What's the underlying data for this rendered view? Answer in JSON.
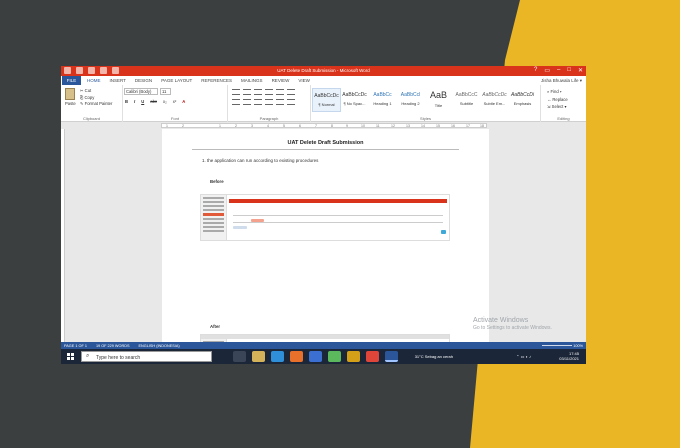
{
  "window": {
    "title": "UAT Delete Draft Submission - Microsoft Word",
    "controls": [
      "?",
      "▭",
      "–",
      "□",
      "✕"
    ]
  },
  "tabs": {
    "file": "FILE",
    "items": [
      "HOME",
      "INSERT",
      "DESIGN",
      "PAGE LAYOUT",
      "REFERENCES",
      "MAILINGS",
      "REVIEW",
      "VIEW"
    ],
    "user": "Jisha Bhuwala Life ▾"
  },
  "ribbon": {
    "clipboard": {
      "paste": "Paste",
      "cut": "✂ Cut",
      "copy": "⎘ Copy",
      "format_painter": "✎ Format Painter",
      "group": "Clipboard"
    },
    "font": {
      "name": "Calibri (Body)",
      "size": "11",
      "bold": "B",
      "italic": "I",
      "underline": "U",
      "strike": "abc",
      "sub": "x₂",
      "sup": "x²",
      "color": "A",
      "group": "Font"
    },
    "paragraph": {
      "group": "Paragraph"
    },
    "styles": {
      "items": [
        {
          "sample": "AaBbCcDc",
          "name": "¶ Normal"
        },
        {
          "sample": "AaBbCcDc",
          "name": "¶ No Spac..."
        },
        {
          "sample": "AaBbCc",
          "name": "Heading 1"
        },
        {
          "sample": "AaBbCcl",
          "name": "Heading 2"
        },
        {
          "sample": "AaB",
          "name": "Title"
        },
        {
          "sample": "AaBbCcC",
          "name": "Subtitle"
        },
        {
          "sample": "AaBbCcDc",
          "name": "Subtle Em..."
        },
        {
          "sample": "AaBbCcDi",
          "name": "Emphasis"
        }
      ],
      "group": "Styles"
    },
    "editing": {
      "find": "⌕ Find ▾",
      "replace": "↔ Replace",
      "select": "⇲ Select ▾",
      "group": "Editing"
    }
  },
  "ruler": {
    "ticks": [
      "1",
      "2",
      "1",
      "2",
      "3",
      "4",
      "5",
      "6",
      "7",
      "8",
      "9",
      "10",
      "11",
      "12",
      "13",
      "14",
      "15",
      "16",
      "17",
      "18"
    ]
  },
  "document": {
    "title": "UAT Delete Draft Submission",
    "step": "1.  the application can run according to existing procedures",
    "before": "Before",
    "after": "After"
  },
  "status": {
    "page": "PAGE 1 OF 1",
    "words": "19 OF 229 WORDS",
    "lang": "ENGLISH (INDONESIA)",
    "zoom": "100%"
  },
  "activation": {
    "line1": "Activate Windows",
    "line2": "Go to Settings to activate Windows."
  },
  "taskbar": {
    "search_placeholder": "Type here to search",
    "weather": "31°C  Sebag an cerah",
    "time": "17:45",
    "date": "03/11/2021"
  },
  "colors": {
    "word_red": "#d9331b",
    "word_blue": "#2b579a",
    "background_gray": "#3b3f40",
    "accent_yellow": "#eab625"
  }
}
